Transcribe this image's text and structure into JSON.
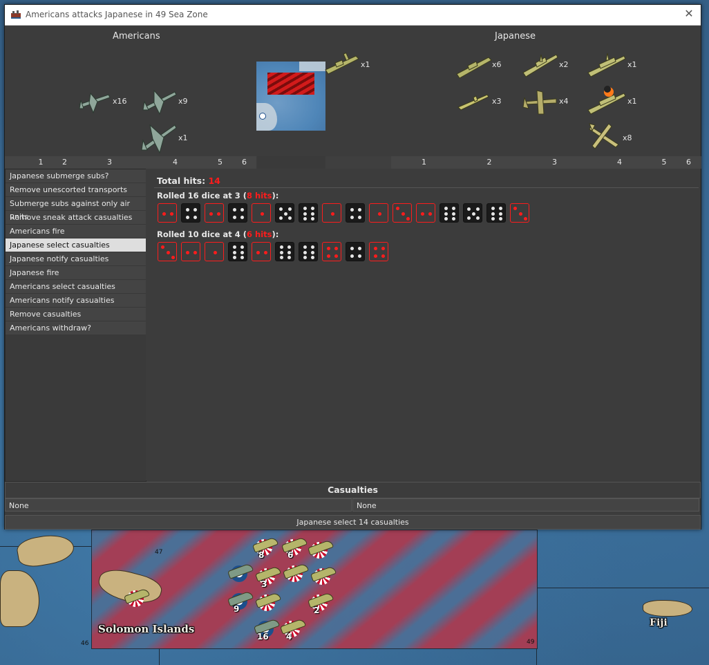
{
  "window": {
    "title": "Americans attacks Japanese in 49 Sea Zone",
    "icon": "game-icon",
    "close_icon": "close-icon"
  },
  "sides": {
    "attacker": "Americans",
    "defender": "Japanese"
  },
  "attacker_units": [
    {
      "name": "fighter",
      "count": "x16"
    },
    {
      "name": "tactical-bomber",
      "count": "x9"
    },
    {
      "name": "bomber",
      "count": "x1"
    }
  ],
  "territory_unit": {
    "name": "transport",
    "count": "x1"
  },
  "defender_units": [
    {
      "name": "transport",
      "count": "x6"
    },
    {
      "name": "cruiser",
      "count": "x2"
    },
    {
      "name": "battleship",
      "count": "x1"
    },
    {
      "name": "submarine",
      "count": "x3"
    },
    {
      "name": "tactical-bomber",
      "count": "x4"
    },
    {
      "name": "damaged-battleship",
      "count": "x1"
    },
    {
      "name": "fighter",
      "count": "x8"
    }
  ],
  "attacker_strip": [
    "1",
    "2",
    "3",
    "4",
    "5",
    "6"
  ],
  "defender_strip": [
    "1",
    "2",
    "3",
    "4",
    "5",
    "6"
  ],
  "steps": [
    {
      "label": "Japanese submerge subs?",
      "selected": false
    },
    {
      "label": "Remove unescorted transports",
      "selected": false
    },
    {
      "label": "Submerge subs against only air units",
      "selected": false
    },
    {
      "label": "Remove sneak attack casualties",
      "selected": false
    },
    {
      "label": "Americans fire",
      "selected": false
    },
    {
      "label": "Japanese select casualties",
      "selected": true
    },
    {
      "label": "Japanese notify casualties",
      "selected": false
    },
    {
      "label": "Japanese fire",
      "selected": false
    },
    {
      "label": "Americans select casualties",
      "selected": false
    },
    {
      "label": "Americans notify casualties",
      "selected": false
    },
    {
      "label": "Remove casualties",
      "selected": false
    },
    {
      "label": "Americans withdraw?",
      "selected": false
    }
  ],
  "dice": {
    "total_label": "Total hits:",
    "total_value": "14",
    "rolls": [
      {
        "prefix": "Rolled 16 dice at 3 (",
        "hits": "8 hits",
        "suffix": "):",
        "values": [
          2,
          4,
          2,
          4,
          1,
          5,
          6,
          1,
          4,
          1,
          3,
          2,
          6,
          5,
          6,
          3
        ],
        "hit_threshold": 3
      },
      {
        "prefix": "Rolled 10 dice at 4 (",
        "hits": "6 hits",
        "suffix": "):",
        "values": [
          3,
          2,
          1,
          6,
          2,
          6,
          6,
          4,
          4,
          4
        ],
        "hit_flags": [
          true,
          true,
          true,
          false,
          true,
          false,
          false,
          true,
          false,
          true
        ]
      }
    ]
  },
  "casualties": {
    "header": "Casualties",
    "attacker": "None",
    "defender": "None"
  },
  "action_button": "Japanese select 14 casualties",
  "map": {
    "territory_label": "Solomon Islands",
    "fiji_label": "Fiji",
    "zone_numbers": [
      "47",
      "46",
      "49"
    ],
    "counter_numbers": [
      "8",
      "6",
      "3",
      "9",
      "2",
      "16",
      "4"
    ]
  },
  "colors": {
    "dialog_bg": "#3c3c3c",
    "hit_red": "#ff1c1c",
    "selected_step": "#dedede"
  }
}
